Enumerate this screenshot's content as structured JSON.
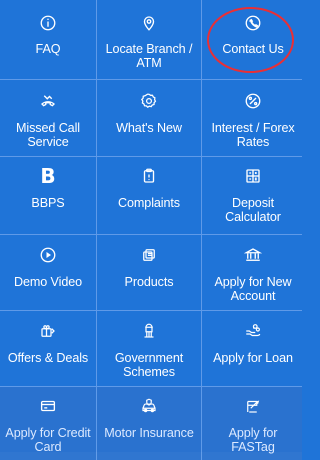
{
  "menu": {
    "items": [
      {
        "label": "FAQ",
        "icon": "info-icon"
      },
      {
        "label": "Locate Branch / ATM",
        "icon": "location-pin-icon"
      },
      {
        "label": "Contact Us",
        "icon": "phone-icon"
      },
      {
        "label": "Missed Call Service",
        "icon": "missed-call-icon"
      },
      {
        "label": "What's New",
        "icon": "new-badge-icon"
      },
      {
        "label": "Interest / Forex Rates",
        "icon": "percent-icon"
      },
      {
        "label": "BBPS",
        "icon": "bbps-icon"
      },
      {
        "label": "Complaints",
        "icon": "complaint-icon"
      },
      {
        "label": "Deposit Calculator",
        "icon": "calculator-icon"
      },
      {
        "label": "Demo Video",
        "icon": "play-icon"
      },
      {
        "label": "Products",
        "icon": "products-icon"
      },
      {
        "label": "Apply for New Account",
        "icon": "bank-icon"
      },
      {
        "label": "Offers & Deals",
        "icon": "offers-icon"
      },
      {
        "label": "Government Schemes",
        "icon": "emblem-icon"
      },
      {
        "label": "Apply for Loan",
        "icon": "loan-icon"
      },
      {
        "label": "Apply for Credit Card",
        "icon": "credit-card-icon"
      },
      {
        "label": "Motor Insurance",
        "icon": "motor-insurance-icon"
      },
      {
        "label": "Apply for FASTag",
        "icon": "fastag-icon"
      }
    ]
  },
  "colors": {
    "tile_background": "#1f74d8",
    "grid_line": "#5f9ae8",
    "highlight_ring": "#ea2f35"
  }
}
